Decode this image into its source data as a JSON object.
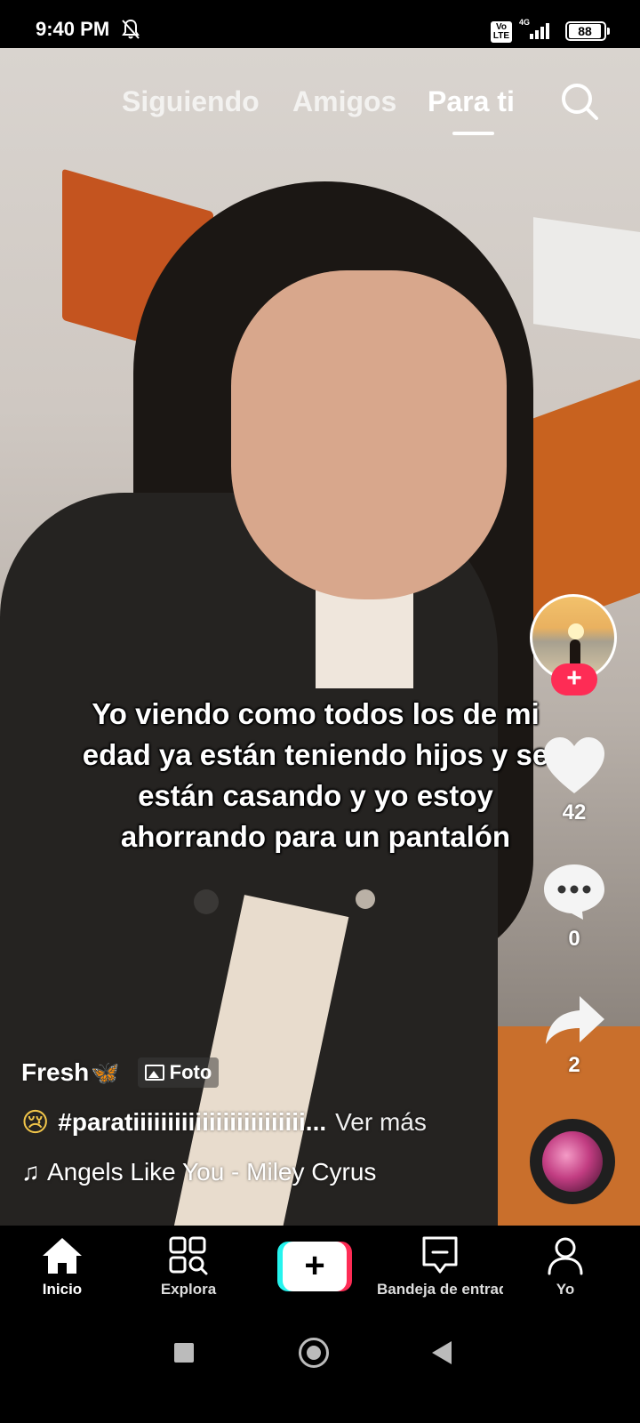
{
  "status_bar": {
    "time": "9:40 PM",
    "volte_label": "Vo\nLTE",
    "network_label": "4G",
    "battery_level": "88",
    "icons": [
      "mute-icon",
      "volte-icon",
      "signal-icon",
      "battery-icon"
    ]
  },
  "top_tabs": {
    "items": [
      {
        "label": "Siguiendo",
        "active": false
      },
      {
        "label": "Amigos",
        "active": false
      },
      {
        "label": "Para ti",
        "active": true
      }
    ],
    "search_icon": "search-icon"
  },
  "post": {
    "caption": "Yo viendo como todos los de mi edad ya están teniendo hijos y se están casando y yo estoy ahorrando para un pantalón",
    "username": "Fresh",
    "username_emoji": "🦋",
    "type_badge": "Foto",
    "description_emoji": "😢",
    "description": "#paratiiiiiiiiiiiiiiiiiiiiiiiii...",
    "see_more": "Ver más",
    "music": "Angels Like You - Miley Cyrus"
  },
  "actions": {
    "follow_label": "+",
    "likes": "42",
    "comments": "0",
    "shares": "2"
  },
  "bottom_nav": {
    "items": [
      {
        "label": "Inicio",
        "icon": "home-icon",
        "active": true
      },
      {
        "label": "Explora",
        "icon": "explore-icon",
        "active": false
      },
      {
        "label": "+",
        "icon": "create-icon",
        "active": false
      },
      {
        "label": "Bandeja de entrada",
        "icon": "inbox-icon",
        "active": false
      },
      {
        "label": "Yo",
        "icon": "profile-icon",
        "active": false
      }
    ]
  },
  "colors": {
    "accent": "#fe2c55",
    "cyan": "#25f4ee"
  }
}
